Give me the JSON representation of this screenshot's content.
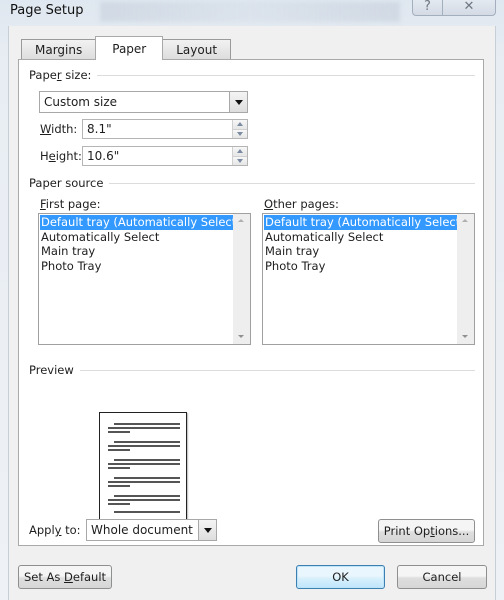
{
  "window": {
    "title": "Page Setup",
    "caption_buttons": {
      "help_icon": "question-mark",
      "close_icon": "x"
    }
  },
  "tabs": [
    {
      "label": "Margins",
      "active": false
    },
    {
      "label": "Paper",
      "active": true
    },
    {
      "label": "Layout",
      "active": false
    }
  ],
  "paper_size": {
    "group_label_pre": "Pape",
    "group_label_accel": "r",
    "group_label_post": " size:",
    "selected": "Custom size",
    "width": {
      "label_accel": "W",
      "label_post": "idth:",
      "value": "8.1\""
    },
    "height": {
      "label_pre": "H",
      "label_accel": "e",
      "label_post": "ight:",
      "value": "10.6\""
    }
  },
  "paper_source": {
    "group_label": "Paper source",
    "first_page": {
      "label_accel": "F",
      "label_post": "irst page:",
      "items": [
        "Default tray (Automatically Select)",
        "Automatically Select",
        "Main tray",
        "Photo Tray"
      ],
      "selected_index": 0
    },
    "other_pages": {
      "label_accel": "O",
      "label_post": "ther pages:",
      "items": [
        "Default tray (Automatically Select)",
        "Automatically Select",
        "Main tray",
        "Photo Tray"
      ],
      "selected_index": 0
    }
  },
  "preview": {
    "group_label": "Preview"
  },
  "apply_to": {
    "label_pre": "Appl",
    "label_accel": "y",
    "label_post": " to:",
    "selected": "Whole document"
  },
  "buttons": {
    "print_options_pre": "Print Op",
    "print_options_accel": "t",
    "print_options_post": "ions...",
    "set_default_pre": "Set As ",
    "set_default_accel": "D",
    "set_default_post": "efault",
    "ok": "OK",
    "cancel": "Cancel"
  }
}
